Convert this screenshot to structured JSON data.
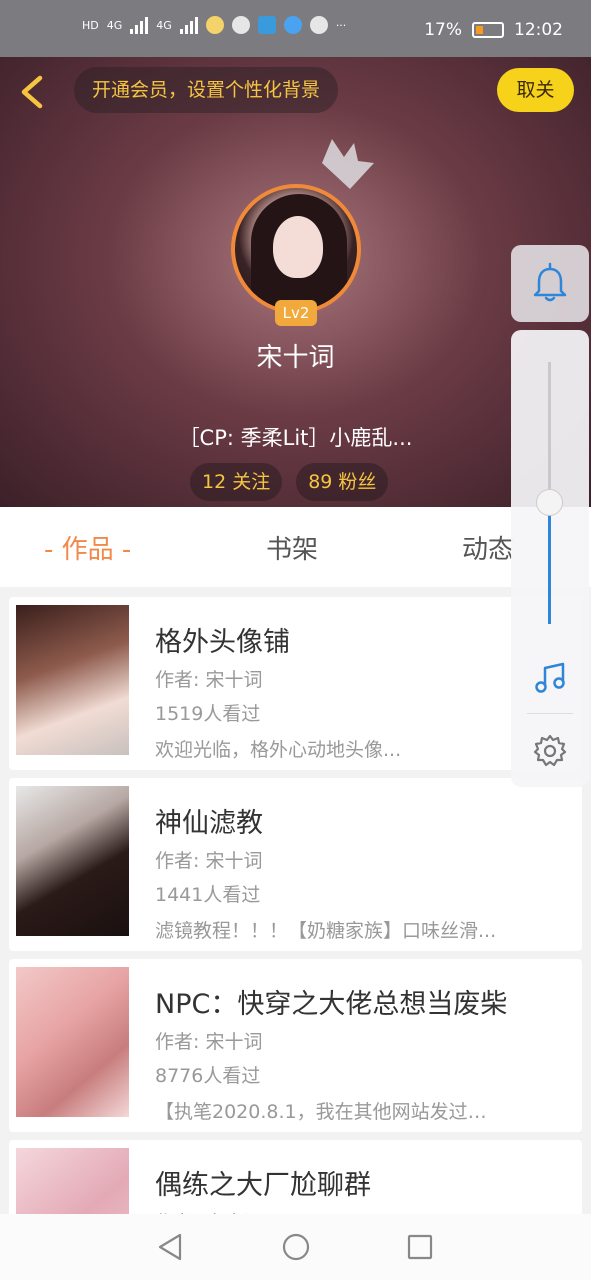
{
  "status_bar": {
    "left_labels": [
      "HD",
      "4G",
      "4G"
    ],
    "battery": "17%",
    "time": "12:02"
  },
  "header": {
    "vip_text": "开通会员，设置个性化背景",
    "cancel_follow": "取关"
  },
  "profile": {
    "level": "Lv2",
    "name": "宋十词",
    "bio": "［CP: 季柔Lit］小鹿乱...",
    "follows": "12 关注",
    "fans": "89 粉丝"
  },
  "tabs": [
    "- 作品 -",
    "书架",
    "动态"
  ],
  "works": [
    {
      "title": "格外头像铺",
      "author": "作者: 宋十词",
      "views": "1519人看过",
      "desc": "欢迎光临，格外心动地头像..."
    },
    {
      "title": "神仙滤教",
      "author": "作者: 宋十词",
      "views": "1441人看过",
      "desc": "滤镜教程！！！【奶糖家族】口味丝滑..."
    },
    {
      "title": "NPC：快穿之大佬总想当废柴",
      "author": "作者: 宋十词",
      "views": "8776人看过",
      "desc": "【执笔2020.8.1，我在其他网站发过…"
    },
    {
      "title": "偶练之大厂尬聊群",
      "author": "作者: 宋十词",
      "views": "",
      "desc": ""
    }
  ],
  "colors": {
    "accent": "#f0894a",
    "gold": "#f5c542",
    "cancel_bg": "#f7d21b",
    "slider_fill": "#2f86d9"
  },
  "icons": {
    "back": "chevron-left-icon",
    "bell": "bell-icon",
    "music": "music-note-icon",
    "settings": "gear-icon"
  },
  "volume_level": 0.47
}
